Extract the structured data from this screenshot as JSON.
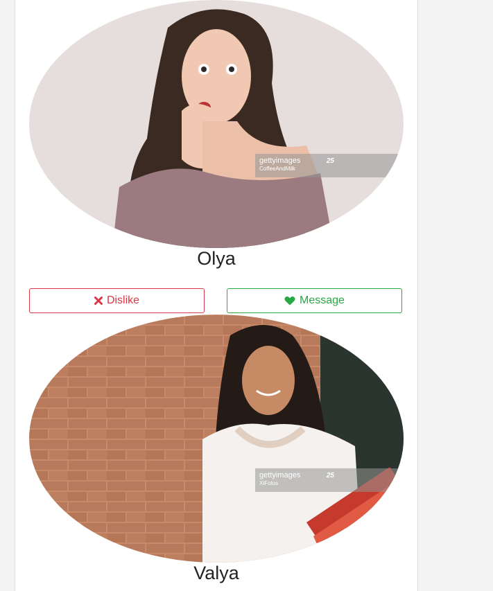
{
  "profiles": [
    {
      "name": "Olya",
      "photo": {
        "watermark_brand": "getty",
        "watermark_brand_suffix": "images",
        "watermark_badge": "25",
        "watermark_credit": "CoffeeAndMilk"
      }
    },
    {
      "name": "Valya",
      "photo": {
        "watermark_brand": "getty",
        "watermark_brand_suffix": "images",
        "watermark_badge": "25",
        "watermark_credit": "XiFotos"
      }
    }
  ],
  "actions": {
    "dislike_label": "Dislike",
    "dislike_icon": "times-icon",
    "message_label": "Message",
    "message_icon": "heart-icon"
  },
  "colors": {
    "dislike": "#dc3545",
    "message": "#28a745"
  }
}
